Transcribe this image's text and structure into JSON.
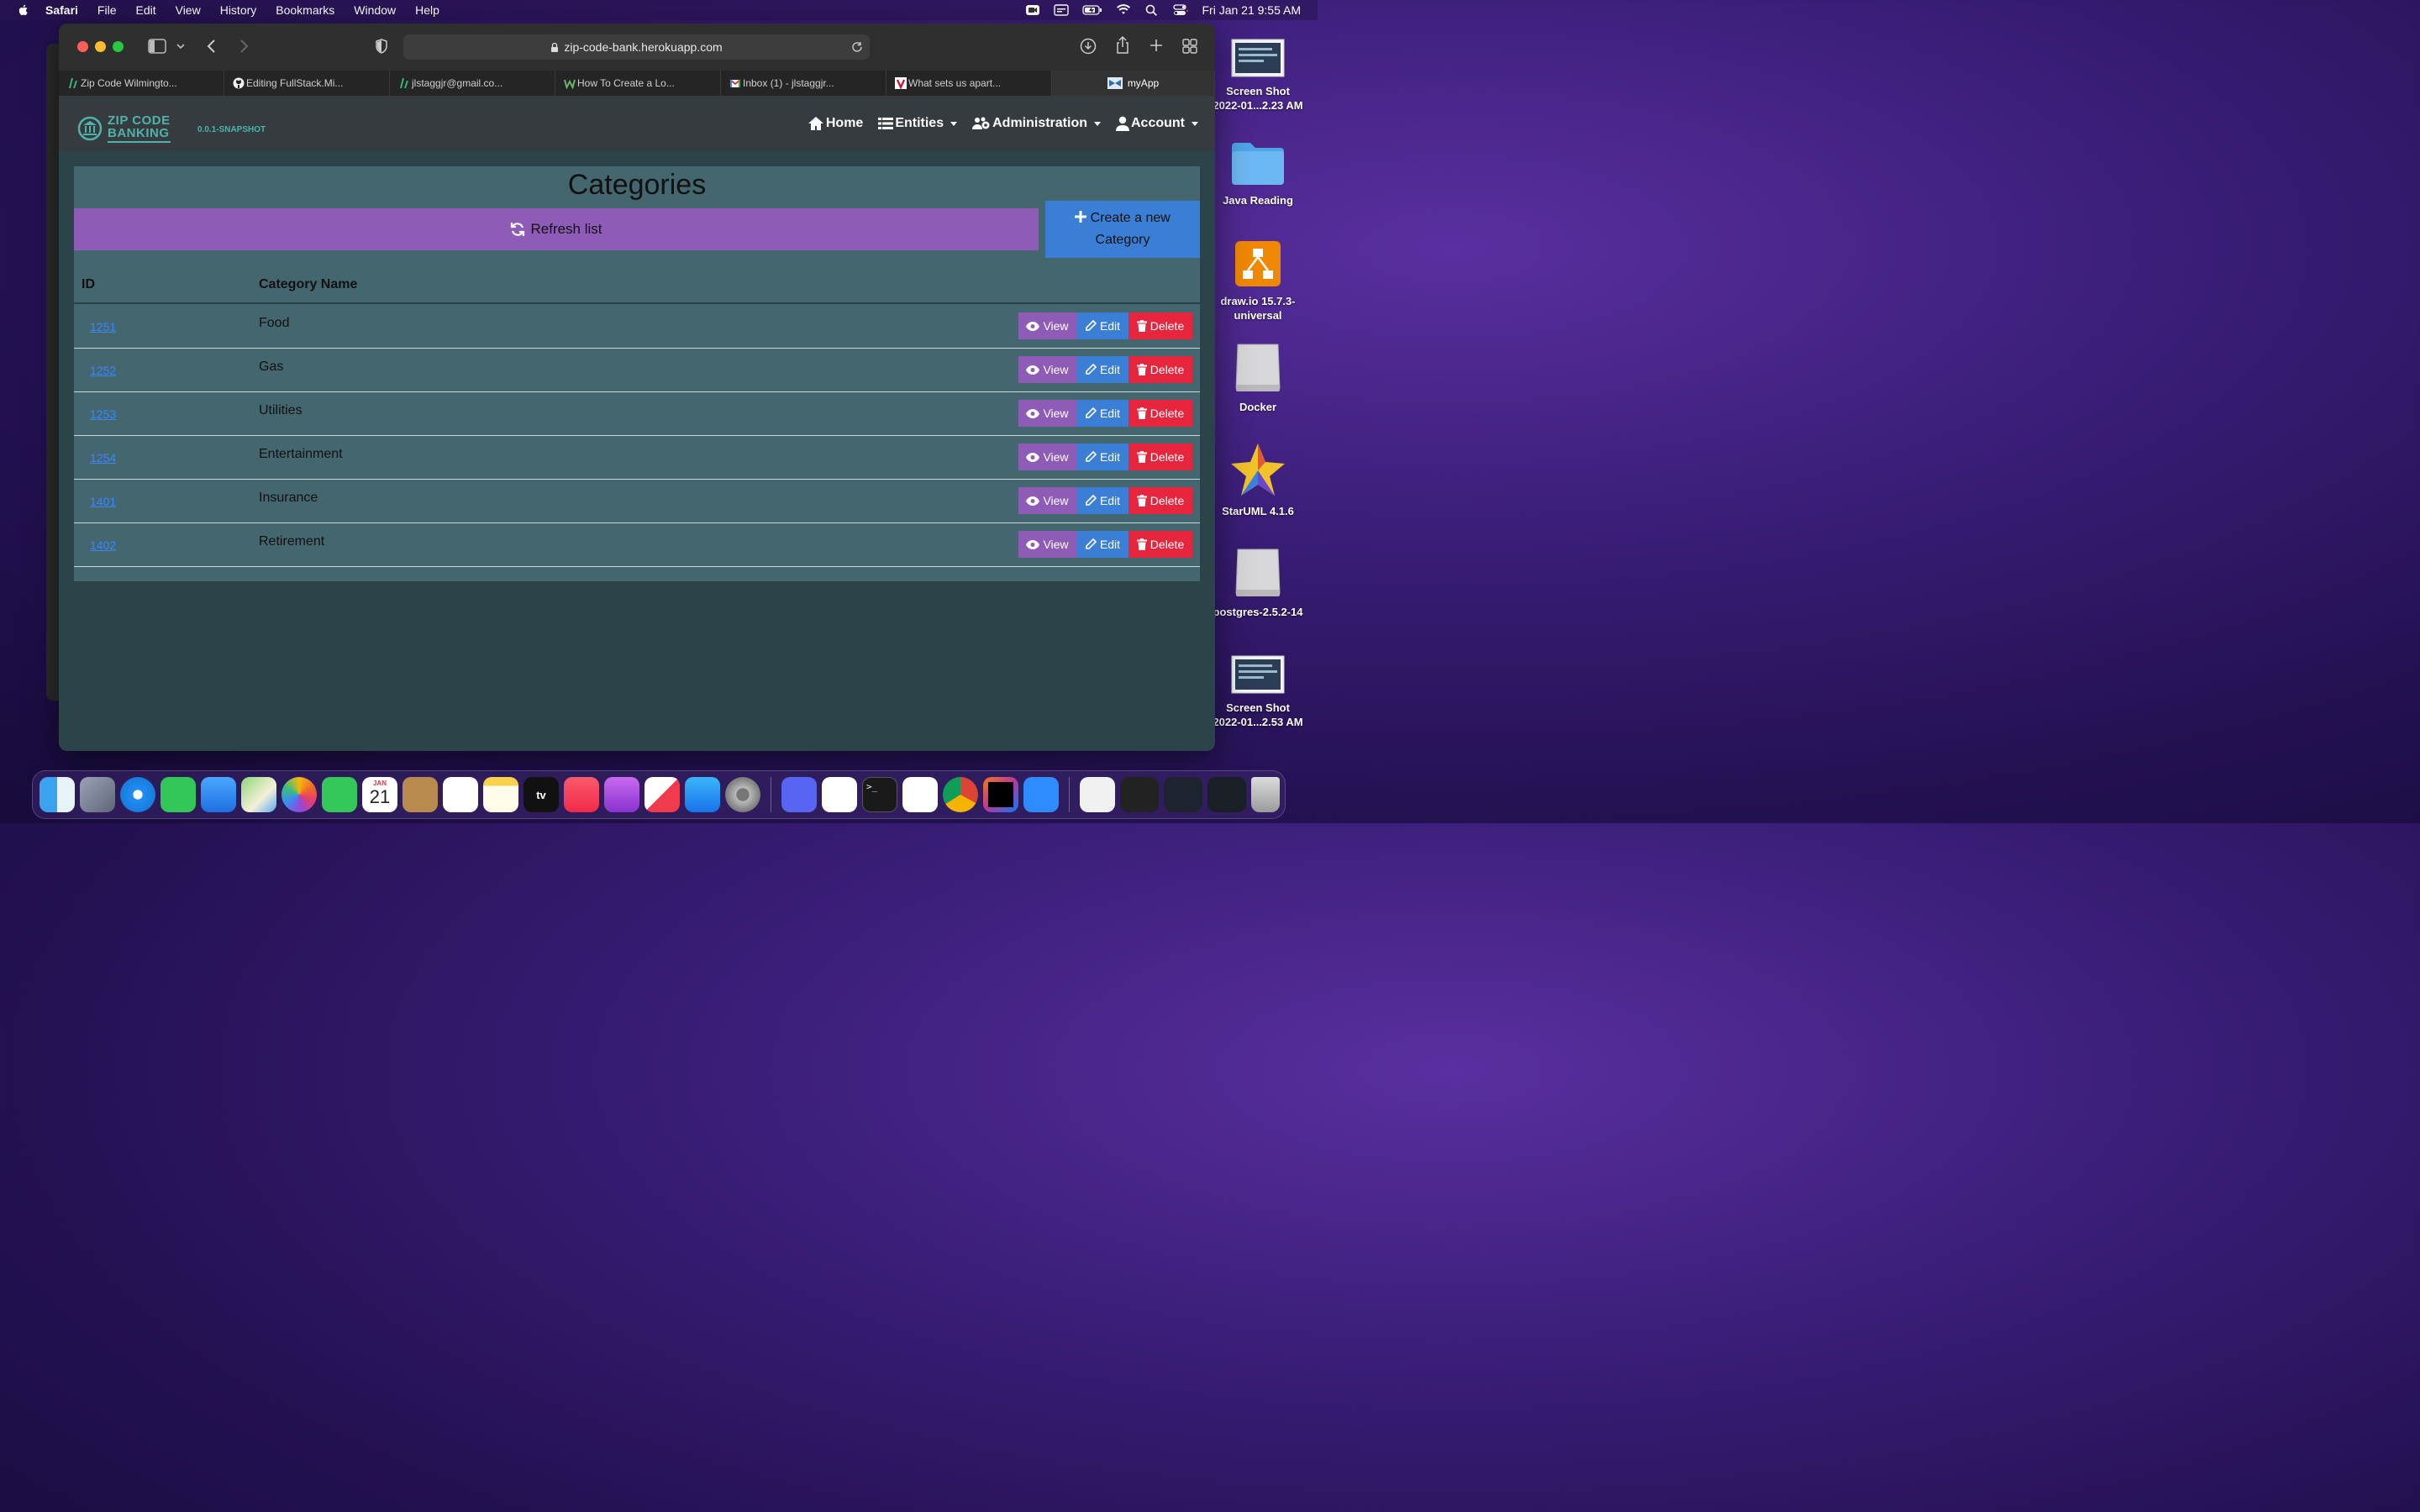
{
  "menubar": {
    "app": "Safari",
    "items": [
      "File",
      "Edit",
      "View",
      "History",
      "Bookmarks",
      "Window",
      "Help"
    ],
    "clock": "Fri Jan 21  9:55 AM"
  },
  "desktop": {
    "icons": [
      {
        "label": "Screen Shot\n2022-01...2.23 AM"
      },
      {
        "label": "Java Reading"
      },
      {
        "label": "draw.io 15.7.3-\nuniversal"
      },
      {
        "label": "Docker"
      },
      {
        "label": "StarUML 4.1.6"
      },
      {
        "label": "postgres-2.5.2-14"
      },
      {
        "label": "Screen Shot\n2022-01...2.53 AM"
      }
    ]
  },
  "browser": {
    "url": "zip-code-bank.herokuapp.com",
    "tabs": [
      {
        "label": "Zip Code Wilmingto..."
      },
      {
        "label": "Editing FullStack.Mi..."
      },
      {
        "label": "jlstaggjr@gmail.co..."
      },
      {
        "label": "How To Create a Lo..."
      },
      {
        "label": "Inbox (1) - jlstaggjr..."
      },
      {
        "label": "What sets us apart..."
      },
      {
        "label": "myApp"
      }
    ]
  },
  "app": {
    "brand_line1": "ZIP CODE",
    "brand_line2": "BANKING",
    "version": "0.0.1-SNAPSHOT",
    "nav": {
      "home": "Home",
      "entities": "Entities",
      "administration": "Administration",
      "account": "Account"
    },
    "page_title": "Categories",
    "refresh_label": "Refresh list",
    "create_line1": "Create a new",
    "create_line2": "Category",
    "columns": {
      "id": "ID",
      "name": "Category Name"
    },
    "rows": [
      {
        "id": "1251",
        "name": "Food"
      },
      {
        "id": "1252",
        "name": "Gas"
      },
      {
        "id": "1253",
        "name": "Utilities"
      },
      {
        "id": "1254",
        "name": "Entertainment"
      },
      {
        "id": "1401",
        "name": "Insurance"
      },
      {
        "id": "1402",
        "name": "Retirement"
      }
    ],
    "actions": {
      "view": "View",
      "edit": "Edit",
      "delete": "Delete"
    }
  },
  "dock": {
    "calendar_month": "JAN",
    "calendar_day": "21",
    "items": [
      "finder-icon",
      "launchpad-icon",
      "safari-icon",
      "messages-icon",
      "mail-icon",
      "maps-icon",
      "photos-icon",
      "facetime-icon",
      "calendar-icon",
      "contacts-icon",
      "reminders-icon",
      "notes-icon",
      "appletv-icon",
      "music-icon",
      "podcasts-icon",
      "news-icon",
      "appstore-icon",
      "settings-icon",
      "discord-icon",
      "slack-icon",
      "terminal-icon",
      "vscode-icon",
      "chrome-icon",
      "intellij-icon",
      "zoom-icon",
      "documents-icon",
      "window-thumb-1",
      "window-thumb-2",
      "window-thumb-3",
      "trash-icon"
    ]
  }
}
